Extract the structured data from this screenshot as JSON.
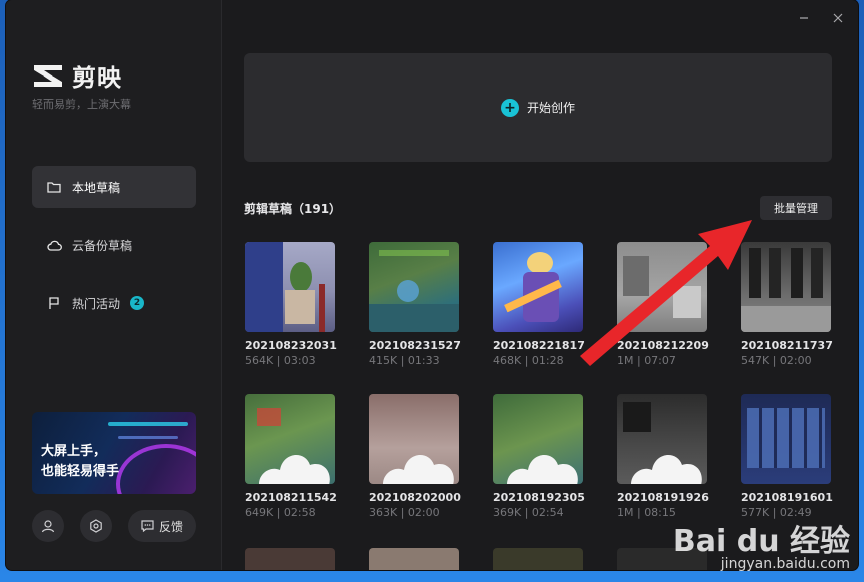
{
  "app": {
    "name": "剪映",
    "slogan": "轻而易剪，上演大幕"
  },
  "sidebar": {
    "items": [
      {
        "label": "本地草稿",
        "icon": "folder-icon",
        "active": true
      },
      {
        "label": "云备份草稿",
        "icon": "cloud-icon",
        "active": false
      },
      {
        "label": "热门活动",
        "icon": "flag-icon",
        "active": false,
        "badge": "2"
      }
    ],
    "promo": {
      "line1": "大屏上手，",
      "line2": "也能轻易得手"
    },
    "feedback_label": "反馈"
  },
  "main": {
    "create_label": "开始创作",
    "drafts_title": "剪辑草稿（191）",
    "batch_label": "批量管理",
    "drafts": [
      {
        "name": "202108232031",
        "meta": "564K | 03:03",
        "thumb": "room"
      },
      {
        "name": "202108231527",
        "meta": "415K | 01:33",
        "thumb": "map"
      },
      {
        "name": "202108221817",
        "meta": "468K | 01:28",
        "thumb": "hero"
      },
      {
        "name": "202108212209",
        "meta": "1M | 07:07",
        "thumb": "grey"
      },
      {
        "name": "202108211737",
        "meta": "547K | 02:00",
        "thumb": "room-dark"
      },
      {
        "name": "202108211542",
        "meta": "649K | 02:58",
        "thumb": "map-cloud"
      },
      {
        "name": "202108202000",
        "meta": "363K | 02:00",
        "thumb": "blur-cloud"
      },
      {
        "name": "202108192305",
        "meta": "369K | 02:54",
        "thumb": "map-cloud"
      },
      {
        "name": "202108191926",
        "meta": "1M | 08:15",
        "thumb": "dark-cloud"
      },
      {
        "name": "202108191601",
        "meta": "577K | 02:49",
        "thumb": "select"
      }
    ]
  },
  "watermark": {
    "brand": "Bai du 经验",
    "url": "jingyan.baidu.com"
  },
  "colors": {
    "accent": "#19c3d6",
    "annotation_arrow": "#e8262a"
  }
}
